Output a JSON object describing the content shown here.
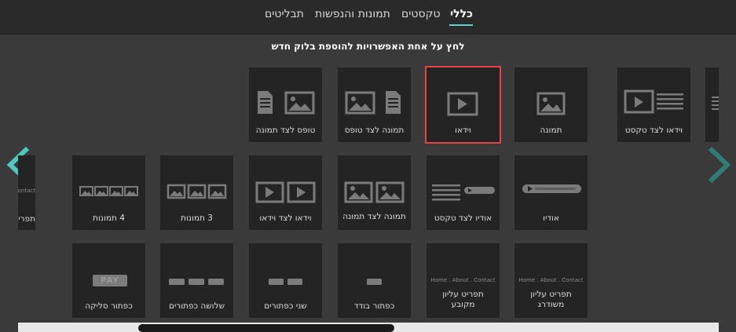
{
  "tabs": [
    {
      "label": "כללי",
      "active": true
    },
    {
      "label": "טקסטים",
      "active": false
    },
    {
      "label": "תמונות והנפשות",
      "active": false
    },
    {
      "label": "תבליטים",
      "active": false
    }
  ],
  "instruction": "לחץ על אחת האפשרויות להוספת בלוק חדש",
  "row1": {
    "partial_left": "",
    "video_beside_text": "וידאו לצד טקסט",
    "image": "תמונה",
    "video": "וידאו",
    "image_beside_form": "תמונה לצד טופס",
    "form_beside_image": "טופס לצד תמונה"
  },
  "row2": {
    "audio": "אודיו",
    "audio_beside_text": "אודיו לצד טקסט",
    "image_beside_image": "תמונה לצד תמונה",
    "video_beside_video": "וידאו לצד וידאו",
    "three_images": "3 תמונות",
    "four_images": "4 תמונות",
    "partial_menu": "תפריט"
  },
  "row3": {
    "menu_highlighted": "תפריט עליון משודרג",
    "menu_fixed": "תפריט עליון מקובע",
    "single_button": "כפתור בודד",
    "two_buttons": "שני כפתורים",
    "three_buttons": "שלושה כפתורים",
    "paypal_button": "כפתור סליקה"
  },
  "menu_preview_text": "Home . About . Contact",
  "menu_preview_partial": "About . Contact",
  "paypal_text": "PAY",
  "colors": {
    "accent": "#5fd1c6",
    "selected": "#e64545",
    "icon": "#7b7b7b"
  }
}
